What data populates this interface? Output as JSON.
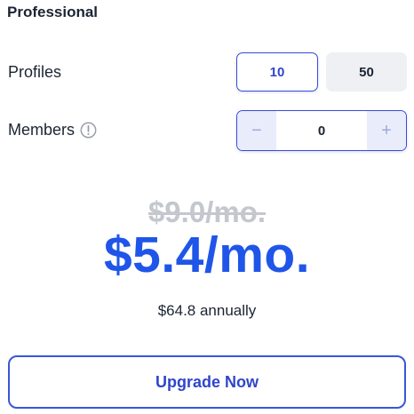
{
  "plan": {
    "title": "Professional"
  },
  "profiles": {
    "label": "Profiles",
    "options": [
      "10",
      "50"
    ],
    "selected": "10"
  },
  "members": {
    "label": "Members",
    "info_icon": "info-circle-icon",
    "value": "0",
    "decrement_symbol": "−",
    "increment_symbol": "+"
  },
  "pricing": {
    "original_price": "$9.0/mo.",
    "discounted_price": "$5.4/mo.",
    "annual_text": "$64.8 annually"
  },
  "actions": {
    "upgrade_label": "Upgrade Now"
  },
  "colors": {
    "accent": "#1f55e8",
    "border_accent": "#3a4bd6",
    "muted_price": "#c4c7cd",
    "option_inactive_bg": "#eef0f4",
    "stepper_btn_bg": "#e9ecfb"
  }
}
